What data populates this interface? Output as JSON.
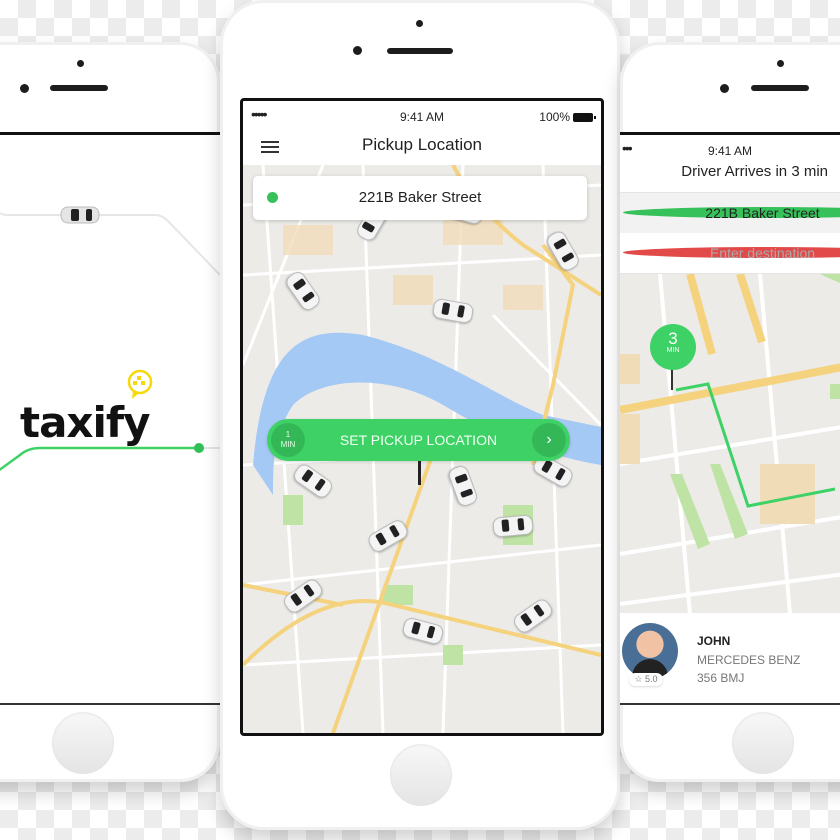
{
  "colors": {
    "accent_green": "#3ed266",
    "destination_red": "#e24a4a",
    "logo_yellow": "#f5d90a",
    "water": "#a5c9f5"
  },
  "left_phone": {
    "logo_text": "taxify",
    "logo_icon": "taxi-pin-icon"
  },
  "center_phone": {
    "status": {
      "signal": "•••••",
      "time": "9:41 AM",
      "battery": "100%"
    },
    "nav_title": "Pickup Location",
    "menu_icon": "hamburger-menu-icon",
    "pickup_address": "221B Baker Street",
    "pickup_button": {
      "eta_value": "1",
      "eta_unit": "MIN",
      "label": "SET PICKUP LOCATION",
      "arrow": "›"
    },
    "cars_on_map": 13
  },
  "right_phone": {
    "status": {
      "signal": "•••",
      "time": "9:41 AM"
    },
    "title": "Driver Arrives in 3 min",
    "pickup_address": "221B Baker Street",
    "destination_placeholder": "Enter destination",
    "eta_pin": {
      "value": "3",
      "unit": "MIN"
    },
    "driver": {
      "name": "JOHN",
      "car": "MERCEDES BENZ",
      "plate": "356 BMJ",
      "rating": "☆ 5.0"
    }
  }
}
